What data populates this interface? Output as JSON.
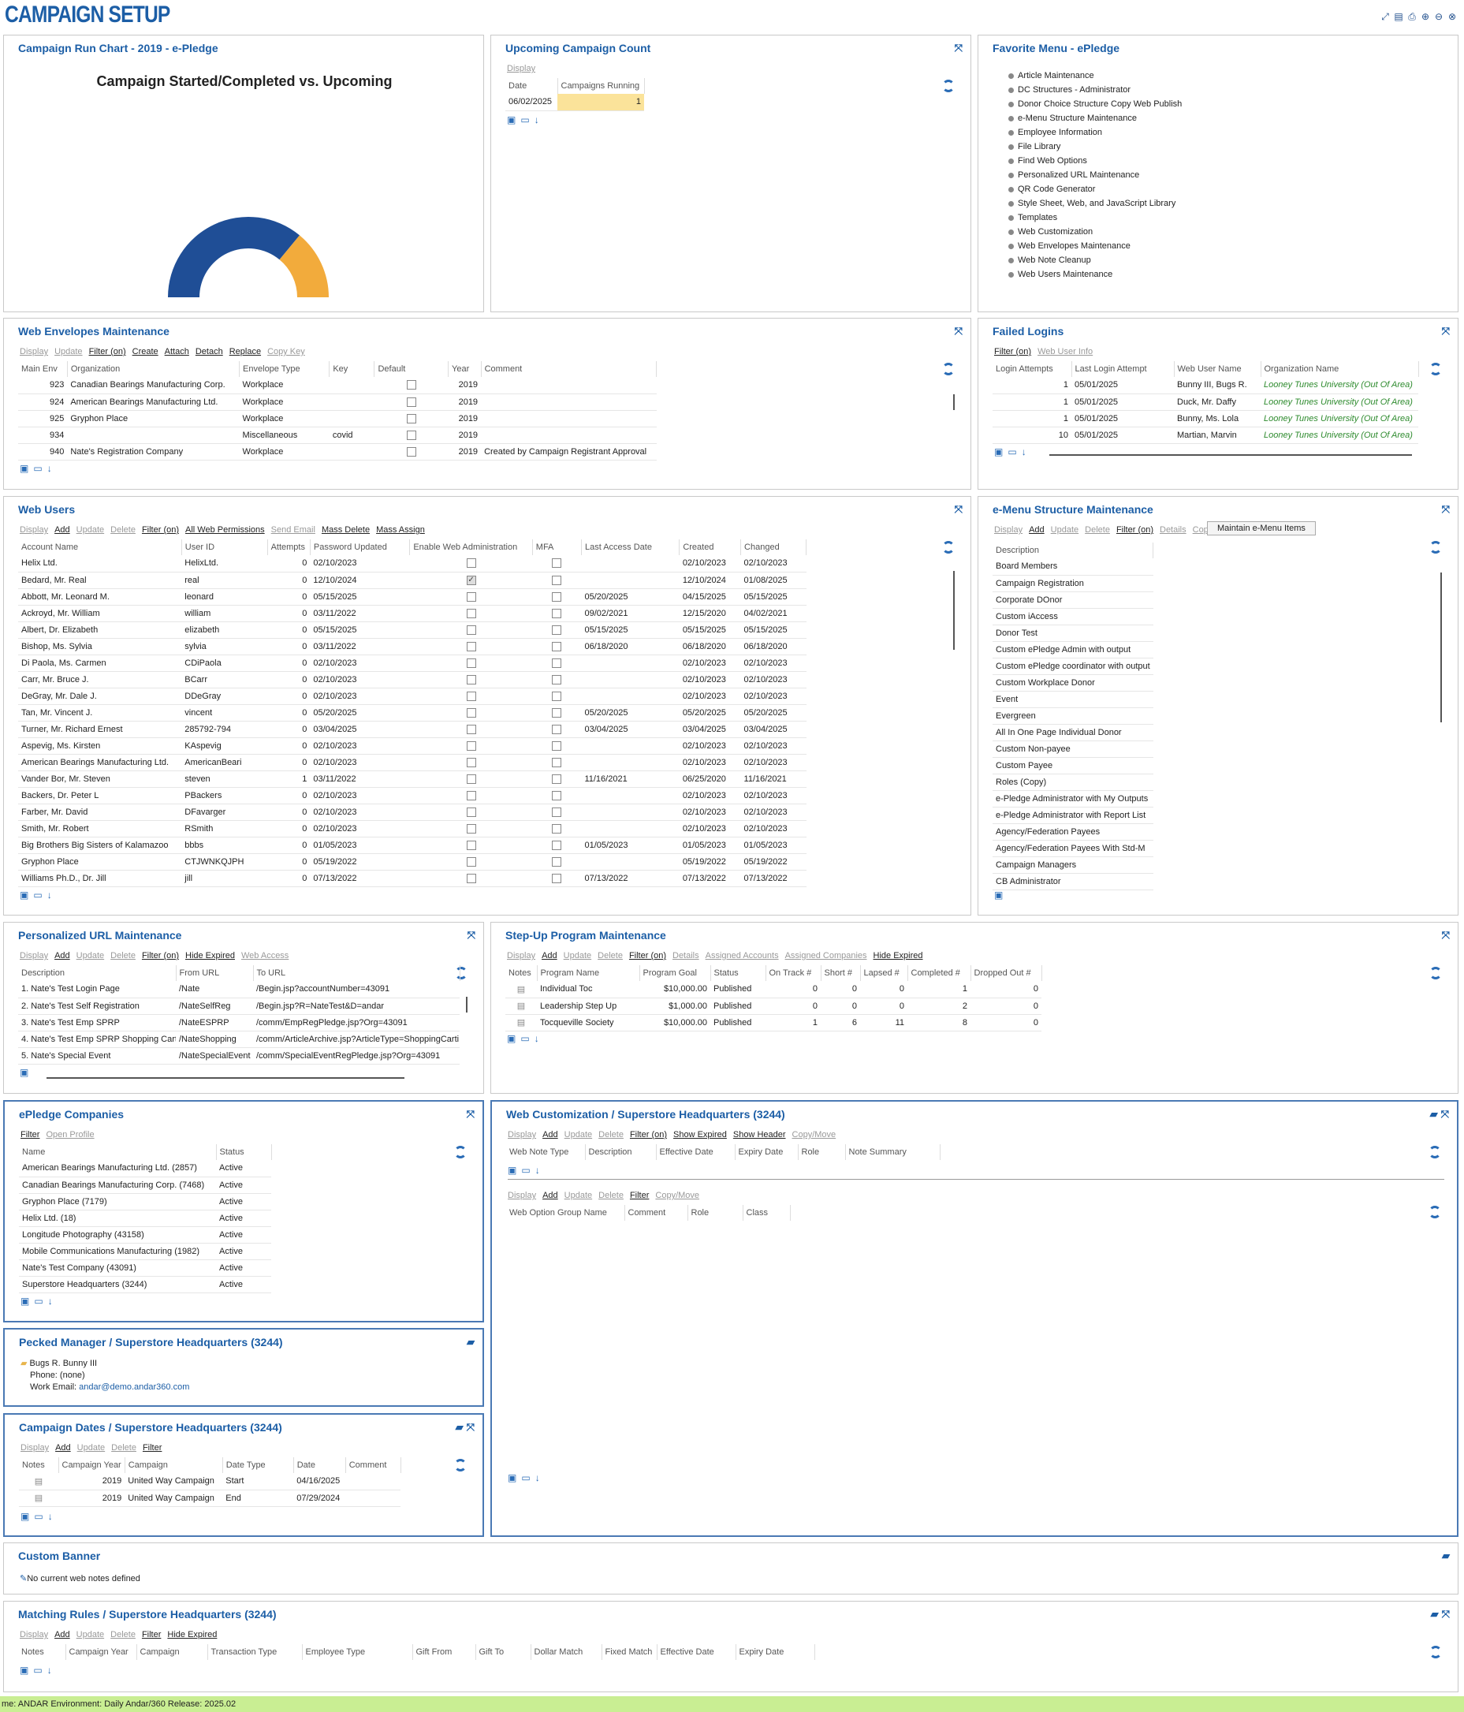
{
  "page": {
    "title": "CAMPAIGN SETUP"
  },
  "status_bar": {
    "text": "me: ANDAR  Environment: Daily  Andar/360 Release: 2025.02"
  },
  "run_chart": {
    "title": "Campaign Run Chart - 2019 - e-Pledge",
    "chart_heading": "Campaign Started/Completed vs. Upcoming",
    "chart_data": {
      "type": "pie",
      "title": "Campaign Started/Completed vs. Upcoming",
      "values": [
        0.72,
        0.28
      ],
      "colors": [
        "#1f4e96",
        "#f2ab3c"
      ]
    }
  },
  "upcoming": {
    "title": "Upcoming Campaign Count",
    "links": [
      "Display"
    ],
    "headers": [
      "Date",
      "Campaigns Running"
    ],
    "rows": [
      [
        "06/02/2025",
        "1"
      ]
    ]
  },
  "favorites": {
    "title": "Favorite Menu - ePledge",
    "items": [
      "Article Maintenance",
      "DC Structures - Administrator",
      "Donor Choice Structure Copy Web Publish",
      "e-Menu Structure Maintenance",
      "Employee Information",
      "File Library",
      "Find Web Options",
      "Personalized URL Maintenance",
      "QR Code Generator",
      "Style Sheet, Web, and JavaScript Library",
      "Templates",
      "Web Customization",
      "Web Envelopes Maintenance",
      "Web Note Cleanup",
      "Web Users Maintenance"
    ]
  },
  "envelopes": {
    "title": "Web Envelopes Maintenance",
    "links": [
      "Display",
      "Update",
      "Filter (on)",
      "Create",
      "Attach",
      "Detach",
      "Replace",
      "Copy Key"
    ],
    "headers": [
      "Main Env",
      "Organization",
      "Envelope Type",
      "Key",
      "Default",
      "Year",
      "Comment"
    ],
    "rows": [
      [
        "923",
        "Canadian Bearings Manufacturing Corp.",
        "Workplace",
        "",
        "",
        "2019",
        ""
      ],
      [
        "924",
        "American Bearings Manufacturing Ltd.",
        "Workplace",
        "",
        "",
        "2019",
        ""
      ],
      [
        "925",
        "Gryphon Place",
        "Workplace",
        "",
        "",
        "2019",
        ""
      ],
      [
        "934",
        "",
        "Miscellaneous",
        "covid",
        "",
        "2019",
        ""
      ],
      [
        "940",
        "Nate's Registration Company",
        "Workplace",
        "",
        "",
        "2019",
        "Created by Campaign Registrant Approval"
      ]
    ]
  },
  "failed": {
    "title": "Failed Logins",
    "links": [
      "Filter (on)",
      "Web User Info"
    ],
    "headers": [
      "Login Attempts",
      "Last Login Attempt",
      "Web User Name",
      "Organization Name"
    ],
    "rows": [
      [
        "1",
        "05/01/2025",
        "Bunny III, Bugs R.",
        "Looney Tunes University (Out Of Area)"
      ],
      [
        "1",
        "05/01/2025",
        "Duck, Mr. Daffy",
        "Looney Tunes University (Out Of Area)"
      ],
      [
        "1",
        "05/01/2025",
        "Bunny, Ms. Lola",
        "Looney Tunes University (Out Of Area)"
      ],
      [
        "10",
        "05/01/2025",
        "Martian, Marvin",
        "Looney Tunes University (Out Of Area)"
      ]
    ]
  },
  "webusers": {
    "title": "Web Users",
    "links": [
      "Display",
      "Add",
      "Update",
      "Delete",
      "Filter (on)",
      "All Web Permissions",
      "Send Email",
      "Mass Delete",
      "Mass Assign"
    ],
    "headers": [
      "Account Name",
      "User ID",
      "Attempts",
      "Password Updated",
      "Enable Web Administration",
      "MFA",
      "Last Access Date",
      "Created",
      "Changed"
    ],
    "rows": [
      [
        "Helix Ltd.",
        "HelixLtd.",
        "0",
        "02/10/2023",
        "",
        "",
        "",
        "02/10/2023",
        "02/10/2023"
      ],
      [
        "Bedard, Mr. Real",
        "real",
        "0",
        "12/10/2024",
        "✓",
        "",
        "",
        "12/10/2024",
        "01/08/2025"
      ],
      [
        "Abbott, Mr. Leonard M.",
        "leonard",
        "0",
        "05/15/2025",
        "",
        "",
        "05/20/2025",
        "04/15/2025",
        "05/15/2025"
      ],
      [
        "Ackroyd, Mr. William",
        "william",
        "0",
        "03/11/2022",
        "",
        "",
        "09/02/2021",
        "12/15/2020",
        "04/02/2021"
      ],
      [
        "Albert, Dr. Elizabeth",
        "elizabeth",
        "0",
        "05/15/2025",
        "",
        "",
        "05/15/2025",
        "05/15/2025",
        "05/15/2025"
      ],
      [
        "Bishop, Ms. Sylvia",
        "sylvia",
        "0",
        "03/11/2022",
        "",
        "",
        "06/18/2020",
        "06/18/2020",
        "06/18/2020"
      ],
      [
        "Di Paola, Ms. Carmen",
        "CDiPaola",
        "0",
        "02/10/2023",
        "",
        "",
        "",
        "02/10/2023",
        "02/10/2023"
      ],
      [
        "Carr, Mr. Bruce J.",
        "BCarr",
        "0",
        "02/10/2023",
        "",
        "",
        "",
        "02/10/2023",
        "02/10/2023"
      ],
      [
        "DeGray, Mr. Dale J.",
        "DDeGray",
        "0",
        "02/10/2023",
        "",
        "",
        "",
        "02/10/2023",
        "02/10/2023"
      ],
      [
        "Tan, Mr. Vincent J.",
        "vincent",
        "0",
        "05/20/2025",
        "",
        "",
        "05/20/2025",
        "05/20/2025",
        "05/20/2025"
      ],
      [
        "Turner, Mr. Richard Ernest",
        "285792-794",
        "0",
        "03/04/2025",
        "",
        "",
        "03/04/2025",
        "03/04/2025",
        "03/04/2025"
      ],
      [
        "Aspevig, Ms. Kirsten",
        "KAspevig",
        "0",
        "02/10/2023",
        "",
        "",
        "",
        "02/10/2023",
        "02/10/2023"
      ],
      [
        "American Bearings Manufacturing Ltd.",
        "AmericanBeari",
        "0",
        "02/10/2023",
        "",
        "",
        "",
        "02/10/2023",
        "02/10/2023"
      ],
      [
        "Vander Bor, Mr. Steven",
        "steven",
        "1",
        "03/11/2022",
        "",
        "",
        "11/16/2021",
        "06/25/2020",
        "11/16/2021"
      ],
      [
        "Backers, Dr. Peter L",
        "PBackers",
        "0",
        "02/10/2023",
        "",
        "",
        "",
        "02/10/2023",
        "02/10/2023"
      ],
      [
        "Farber, Mr. David",
        "DFavarger",
        "0",
        "02/10/2023",
        "",
        "",
        "",
        "02/10/2023",
        "02/10/2023"
      ],
      [
        "Smith, Mr. Robert",
        "RSmith",
        "0",
        "02/10/2023",
        "",
        "",
        "",
        "02/10/2023",
        "02/10/2023"
      ],
      [
        "Big Brothers Big Sisters of Kalamazoo",
        "bbbs",
        "0",
        "01/05/2023",
        "",
        "",
        "01/05/2023",
        "01/05/2023",
        "01/05/2023"
      ],
      [
        "Gryphon Place",
        "CTJWNKQJPH",
        "0",
        "05/19/2022",
        "",
        "",
        "",
        "05/19/2022",
        "05/19/2022"
      ],
      [
        "Williams Ph.D., Dr. Jill",
        "jill",
        "0",
        "07/13/2022",
        "",
        "",
        "07/13/2022",
        "07/13/2022",
        "07/13/2022"
      ]
    ]
  },
  "emenu": {
    "title": "e-Menu Structure Maintenance",
    "links": [
      "Display",
      "Add",
      "Update",
      "Delete",
      "Filter (on)",
      "Details",
      "Copy"
    ],
    "button": "Maintain e-Menu Items",
    "header": "Description",
    "rows": [
      "Board Members",
      "Campaign Registration",
      "Corporate DOnor",
      "Custom iAccess",
      "Donor Test",
      "Custom ePledge Admin with output",
      "Custom ePledge coordinator with output",
      "Custom Workplace Donor",
      "Event",
      "Evergreen",
      "All In One Page Individual Donor",
      "Custom Non-payee",
      "Custom Payee",
      "Roles (Copy)",
      "e-Pledge Administrator with My Outputs",
      "e-Pledge Administrator with Report List",
      "Agency/Federation Payees",
      "Agency/Federation Payees With Std-M",
      "Campaign Managers",
      "CB Administrator"
    ]
  },
  "purl": {
    "title": "Personalized URL Maintenance",
    "links": [
      "Display",
      "Add",
      "Update",
      "Delete",
      "Filter (on)",
      "Hide Expired",
      "Web Access"
    ],
    "headers": [
      "Description",
      "From URL",
      "To URL"
    ],
    "rows": [
      [
        "1. Nate's Test Login Page",
        "/Nate",
        "/Begin.jsp?accountNumber=43091"
      ],
      [
        "2. Nate's Test Self Registration",
        "/NateSelfReg",
        "/Begin.jsp?R=NateTest&D=andar"
      ],
      [
        "3. Nate's Test Emp SPRP",
        "/NateESPRP",
        "/comm/EmpRegPledge.jsp?Org=43091"
      ],
      [
        "4. Nate's Test Emp SPRP Shopping Cart",
        "/NateShopping",
        "/comm/ArticleArchive.jsp?ArticleType=ShoppingCarti"
      ],
      [
        "5. Nate's Special Event",
        "/NateSpecialEvent",
        "/comm/SpecialEventRegPledge.jsp?Org=43091"
      ]
    ]
  },
  "stepup": {
    "title": "Step-Up Program Maintenance",
    "links": [
      "Display",
      "Add",
      "Update",
      "Delete",
      "Filter (on)",
      "Details",
      "Assigned Accounts",
      "Assigned Companies",
      "Hide Expired"
    ],
    "headers": [
      "Notes",
      "Program Name",
      "Program Goal",
      "Status",
      "On Track #",
      "Short #",
      "Lapsed #",
      "Completed #",
      "Dropped Out #"
    ],
    "rows": [
      [
        "",
        "Individual Toc",
        "$10,000.00",
        "Published",
        "0",
        "0",
        "0",
        "1",
        "0"
      ],
      [
        "",
        "Leadership Step Up",
        "$1,000.00",
        "Published",
        "0",
        "0",
        "0",
        "2",
        "0"
      ],
      [
        "",
        "Tocqueville Society",
        "$10,000.00",
        "Published",
        "1",
        "6",
        "11",
        "8",
        "0"
      ]
    ]
  },
  "companies": {
    "title": "ePledge Companies",
    "links": [
      "Filter",
      "Open Profile"
    ],
    "headers": [
      "Name",
      "Status"
    ],
    "rows": [
      [
        "American Bearings Manufacturing Ltd.  (2857)",
        "Active"
      ],
      [
        "Canadian Bearings Manufacturing Corp.  (7468)",
        "Active"
      ],
      [
        "Gryphon Place  (7179)",
        "Active"
      ],
      [
        "Helix Ltd.  (18)",
        "Active"
      ],
      [
        "Longitude Photography  (43158)",
        "Active"
      ],
      [
        "Mobile Communications Manufacturing  (1982)",
        "Active"
      ],
      [
        "Nate's Test Company  (43091)",
        "Active"
      ],
      [
        "Superstore Headquarters  (3244)",
        "Active"
      ]
    ]
  },
  "webcust": {
    "title": "Web Customization / Superstore Headquarters (3244)",
    "links1": [
      "Display",
      "Add",
      "Update",
      "Delete",
      "Filter (on)",
      "Show Expired",
      "Show Header",
      "Copy/Move"
    ],
    "headers1": [
      "Web Note Type",
      "Description",
      "Effective Date",
      "Expiry Date",
      "Role",
      "Note Summary"
    ],
    "links2": [
      "Display",
      "Add",
      "Update",
      "Delete",
      "Filter",
      "Copy/Move"
    ],
    "headers2": [
      "Web Option Group Name",
      "Comment",
      "Role",
      "Class"
    ]
  },
  "pecked": {
    "title": "Pecked Manager / Superstore Headquarters (3244)",
    "name": "Bugs R. Bunny III",
    "phone": "Phone: (none)",
    "email_label": "Work Email:",
    "email": "andar@demo.andar360.com"
  },
  "dates": {
    "title": "Campaign Dates / Superstore Headquarters (3244)",
    "links": [
      "Display",
      "Add",
      "Update",
      "Delete",
      "Filter"
    ],
    "headers": [
      "Notes",
      "Campaign Year",
      "Campaign",
      "Date Type",
      "Date",
      "Comment"
    ],
    "rows": [
      [
        "",
        "2019",
        "United Way Campaign",
        "Start",
        "04/16/2025",
        ""
      ],
      [
        "",
        "2019",
        "United Way Campaign",
        "End",
        "07/29/2024",
        ""
      ]
    ]
  },
  "banner": {
    "title": "Custom Banner",
    "text": "No current web notes defined"
  },
  "matching": {
    "title": "Matching Rules / Superstore Headquarters (3244)",
    "links": [
      "Display",
      "Add",
      "Update",
      "Delete",
      "Filter",
      "Hide Expired"
    ],
    "headers": [
      "Notes",
      "Campaign Year",
      "Campaign",
      "Transaction Type",
      "Employee Type",
      "Gift From",
      "Gift To",
      "Dollar Match",
      "Fixed Match",
      "Effective Date",
      "Expiry Date"
    ]
  }
}
